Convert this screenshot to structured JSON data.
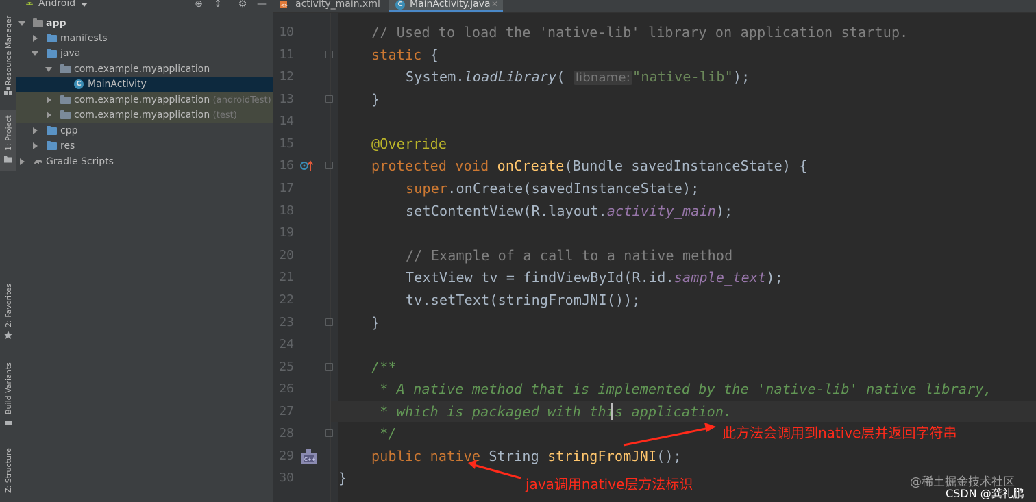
{
  "project_panel": {
    "title": "Android",
    "tree": [
      {
        "label": "app",
        "suffix": ""
      },
      {
        "label": "manifests",
        "suffix": ""
      },
      {
        "label": "java",
        "suffix": ""
      },
      {
        "label": "com.example.myapplication",
        "suffix": ""
      },
      {
        "label": "MainActivity",
        "suffix": ""
      },
      {
        "label": "com.example.myapplication",
        "suffix": "(androidTest)"
      },
      {
        "label": "com.example.myapplication",
        "suffix": "(test)"
      },
      {
        "label": "cpp",
        "suffix": ""
      },
      {
        "label": "res",
        "suffix": ""
      },
      {
        "label": "Gradle Scripts",
        "suffix": ""
      }
    ]
  },
  "side_tabs": {
    "resource_manager": "Resource Manager",
    "project": "1: Project",
    "favorites": "2: Favorites",
    "build_variants": "Build Variants",
    "structure": "Z: Structure"
  },
  "editor_tabs": [
    {
      "name": "activity_main.xml",
      "active": false
    },
    {
      "name": "MainActivity.java",
      "active": true
    }
  ],
  "line_numbers": [
    "10",
    "11",
    "12",
    "13",
    "14",
    "15",
    "16",
    "17",
    "18",
    "19",
    "20",
    "21",
    "22",
    "23",
    "24",
    "25",
    "26",
    "27",
    "28",
    "29",
    "30"
  ],
  "code": {
    "l10": "// Used to load the 'native-lib' library on application startup.",
    "l11_kw": "static",
    "l11_rest": " {",
    "l12_a": "System.",
    "l12_b": "loadLibrary",
    "l12_c": "( ",
    "l12_hint": "libname:",
    "l12_str": "\"native-lib\"",
    "l12_d": ");",
    "l13": "}",
    "l15": "@Override",
    "l16_kw": "protected void ",
    "l16_fn": "onCreate",
    "l16_rest": "(Bundle savedInstanceState) {",
    "l17_kw": "super",
    "l17_rest": ".onCreate(savedInstanceState);",
    "l18_a": "setContentView(R.layout.",
    "l18_fld": "activity_main",
    "l18_b": ");",
    "l20": "// Example of a call to a native method",
    "l21_a": "TextView tv = findViewById(R.id.",
    "l21_fld": "sample_text",
    "l21_b": ");",
    "l22": "tv.setText(stringFromJNI());",
    "l23": "}",
    "l25": "/**",
    "l26": " * A native method that is implemented by the 'native-lib' native library,",
    "l27": " * which is packaged with this application.",
    "l28": " */",
    "l29_kw": "public native ",
    "l29_type": "String ",
    "l29_fn": "stringFromJNI",
    "l29_rest": "();",
    "l30": "}"
  },
  "annotations": {
    "upper": "此方法会调用到native层并返回字符串",
    "lower": "java调用native层方法标识",
    "color": "#ff2a1a"
  },
  "watermark": {
    "site": "@稀土掘金技术社区",
    "csdn": "CSDN @龚礼鹏"
  },
  "colors": {
    "keyword": "#cc7832",
    "comment": "#808080",
    "doc_comment": "#629755",
    "string": "#6a8759",
    "function": "#ffc66d",
    "annotation": "#bbb529",
    "field": "#9876aa",
    "selection": "#0d293e"
  }
}
